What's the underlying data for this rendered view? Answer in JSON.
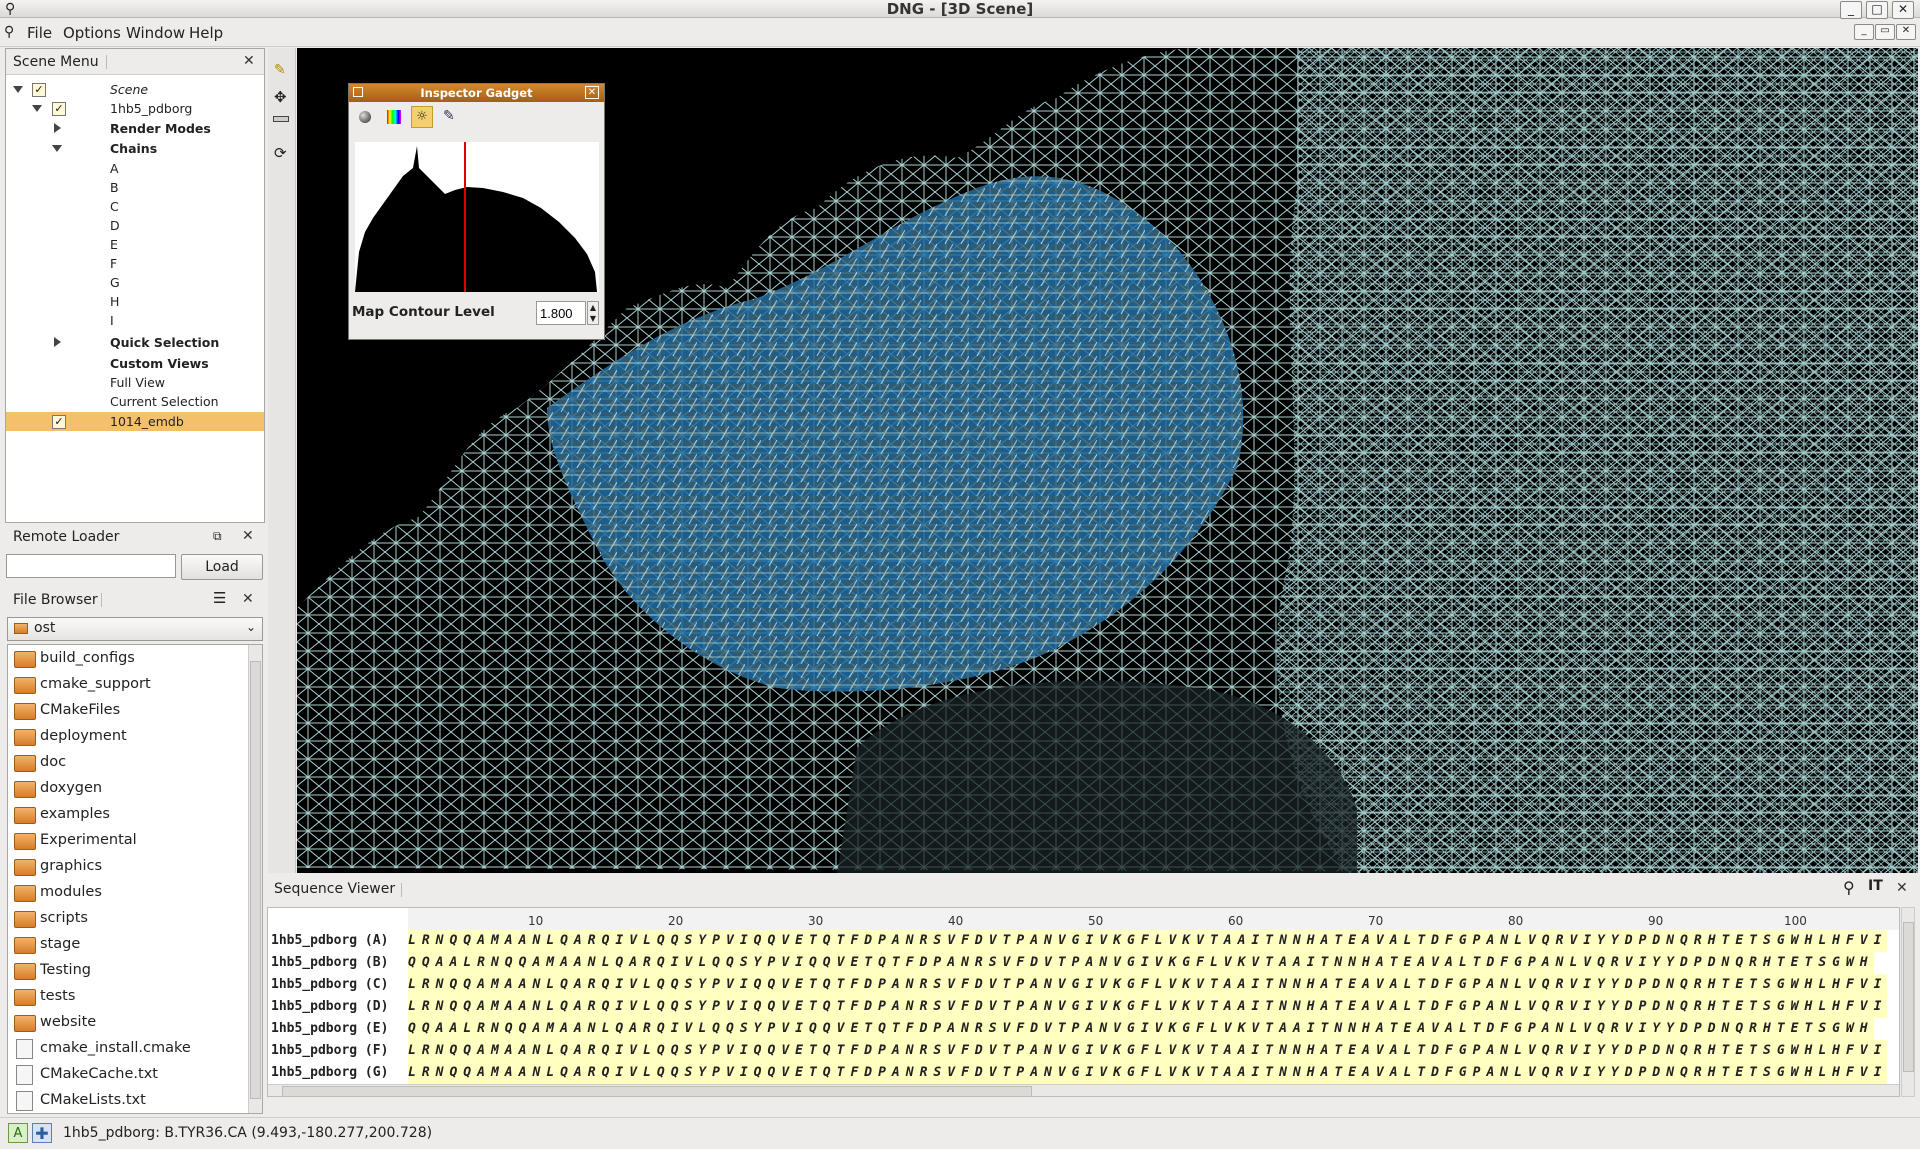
{
  "window": {
    "title": "DNG - [3D Scene]"
  },
  "menu": [
    "File",
    "Options",
    "Window",
    "Help"
  ],
  "scene_menu": {
    "title": "Scene Menu",
    "tree": [
      {
        "label": "Scene",
        "italic": true
      },
      {
        "label": "1hb5_pdborg"
      },
      {
        "label": "Render Modes",
        "bold": true
      },
      {
        "label": "Chains",
        "bold": true
      },
      {
        "label": "A"
      },
      {
        "label": "B"
      },
      {
        "label": "C"
      },
      {
        "label": "D"
      },
      {
        "label": "E"
      },
      {
        "label": "F"
      },
      {
        "label": "G"
      },
      {
        "label": "H"
      },
      {
        "label": "I"
      },
      {
        "label": "Quick Selection",
        "bold": true
      },
      {
        "label": "Custom Views",
        "bold": true
      },
      {
        "label": "Full View"
      },
      {
        "label": "Current Selection"
      },
      {
        "label": "1014_emdb",
        "selected": true
      }
    ]
  },
  "remote_loader": {
    "title": "Remote Loader",
    "input_value": "",
    "load_label": "Load"
  },
  "file_browser": {
    "title": "File Browser",
    "path": "ost",
    "folders": [
      "build_configs",
      "cmake_support",
      "CMakeFiles",
      "deployment",
      "doc",
      "doxygen",
      "examples",
      "Experimental",
      "graphics",
      "modules",
      "scripts",
      "stage",
      "Testing",
      "tests",
      "website"
    ],
    "files": [
      "cmake_install.cmake",
      "CMakeCache.txt",
      "CMakeLists.txt"
    ]
  },
  "inspector_gadget": {
    "title": "Inspector Gadget",
    "contour_label": "Map Contour Level",
    "contour_value": "1.800",
    "marker_fraction": 0.45
  },
  "sequence_viewer": {
    "title": "Sequence Viewer",
    "ruler": [
      "10",
      "20",
      "30",
      "40",
      "50",
      "60",
      "70",
      "80",
      "90",
      "100"
    ],
    "rows": [
      {
        "name": "1hb5_pdborg (A)",
        "seq": "LRNQQAMAANLQARQIVLQQSYPVIQQVETQTFDPANRSVFDVTPANVGIVKGFLVKVTAAITNNHATEAVALTDFGPANLVQRVIYYDPDNQRHTETSGWHLHFVI"
      },
      {
        "name": "1hb5_pdborg (B)",
        "seq": "QQAALRNQQAMAANLQARQIVLQQSYPVIQQVETQTFDPANRSVFDVTPANVGIVKGFLVKVTAAITNNHATEAVALTDFGPANLVQRVIYYDPDNQRHTETSGWH"
      },
      {
        "name": "1hb5_pdborg (C)",
        "seq": "LRNQQAMAANLQARQIVLQQSYPVIQQVETQTFDPANRSVFDVTPANVGIVKGFLVKVTAAITNNHATEAVALTDFGPANLVQRVIYYDPDNQRHTETSGWHLHFVI"
      },
      {
        "name": "1hb5_pdborg (D)",
        "seq": "LRNQQAMAANLQARQIVLQQSYPVIQQVETQTFDPANRSVFDVTPANVGIVKGFLVKVTAAITNNHATEAVALTDFGPANLVQRVIYYDPDNQRHTETSGWHLHFVI"
      },
      {
        "name": "1hb5_pdborg (E)",
        "seq": "QQAALRNQQAMAANLQARQIVLQQSYPVIQQVETQTFDPANRSVFDVTPANVGIVKGFLVKVTAAITNNHATEAVALTDFGPANLVQRVIYYDPDNQRHTETSGWH"
      },
      {
        "name": "1hb5_pdborg (F)",
        "seq": "LRNQQAMAANLQARQIVLQQSYPVIQQVETQTFDPANRSVFDVTPANVGIVKGFLVKVTAAITNNHATEAVALTDFGPANLVQRVIYYDPDNQRHTETSGWHLHFVI"
      },
      {
        "name": "1hb5_pdborg (G)",
        "seq": "LRNQQAMAANLQARQIVLQQSYPVIQQVETQTFDPANRSVFDVTPANVGIVKGFLVKVTAAITNNHATEAVALTDFGPANLVQRVIYYDPDNQRHTETSGWHLHFVI"
      }
    ]
  },
  "status": {
    "text": "1hb5_pdborg: B.TYR36.CA (9.493,-180.277,200.728)"
  },
  "colors": {
    "selection": "#f4c06b",
    "mesh": "#a8cfd0",
    "surface": "#1e6fa8",
    "accent": "#d48a30"
  }
}
